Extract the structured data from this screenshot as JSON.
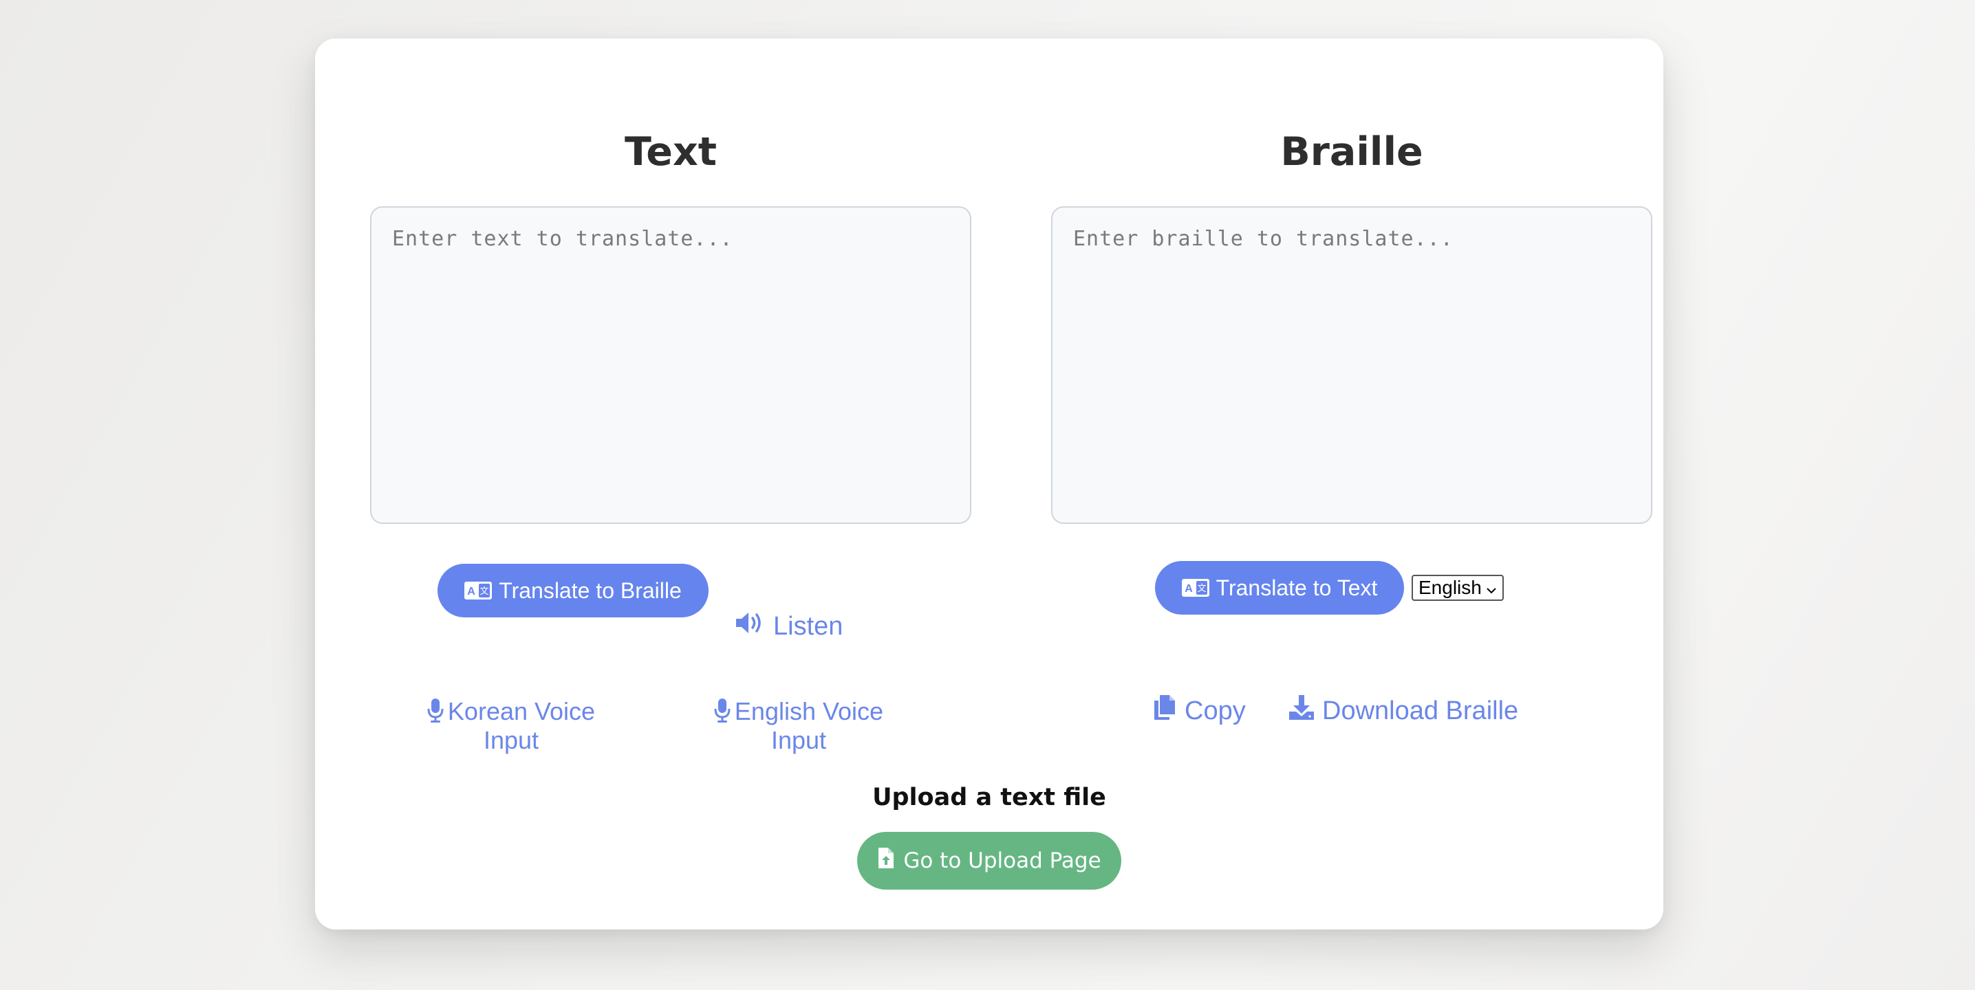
{
  "left_panel": {
    "title": "Text",
    "placeholder": "Enter text to translate...",
    "translate_button": "Translate to Braille",
    "listen_button": "Listen",
    "korean_voice_line1": "Korean Voice",
    "korean_voice_line2": "Input",
    "english_voice_line1": "English Voice",
    "english_voice_line2": "Input"
  },
  "right_panel": {
    "title": "Braille",
    "placeholder": "Enter braille to translate...",
    "translate_button": "Translate to Text",
    "language_select": {
      "selected": "English"
    },
    "copy_button": "Copy",
    "download_button": "Download Braille"
  },
  "upload": {
    "label": "Upload a text file",
    "button": "Go to Upload Page"
  },
  "colors": {
    "primary_blue": "#6584ee",
    "link_blue": "#6a86e8",
    "upload_green": "#66b684"
  },
  "icons": {
    "translate": "translate-icon",
    "listen": "volume-icon",
    "microphone": "microphone-icon",
    "copy": "copy-icon",
    "download": "download-icon",
    "upload_file": "file-upload-icon"
  }
}
